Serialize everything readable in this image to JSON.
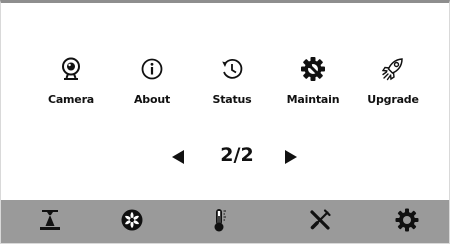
{
  "menu": {
    "items": [
      {
        "label": "Camera",
        "icon": "webcam-icon"
      },
      {
        "label": "About",
        "icon": "info-icon"
      },
      {
        "label": "Status",
        "icon": "history-clock-icon"
      },
      {
        "label": "Maintain",
        "icon": "gear-wrench-icon"
      },
      {
        "label": "Upgrade",
        "icon": "rocket-icon"
      }
    ]
  },
  "pager": {
    "indicator": "2/2",
    "prev_icon": "triangle-left-icon",
    "next_icon": "triangle-right-icon"
  },
  "toolbar": {
    "items": [
      {
        "icon": "print-bed-icon"
      },
      {
        "icon": "fan-icon"
      },
      {
        "icon": "thermometer-icon"
      },
      {
        "icon": "tools-icon"
      },
      {
        "icon": "settings-gear-icon"
      }
    ]
  },
  "colors": {
    "toolbar_bg": "#9a9a9a",
    "icon": "#111111",
    "background": "#ffffff"
  }
}
